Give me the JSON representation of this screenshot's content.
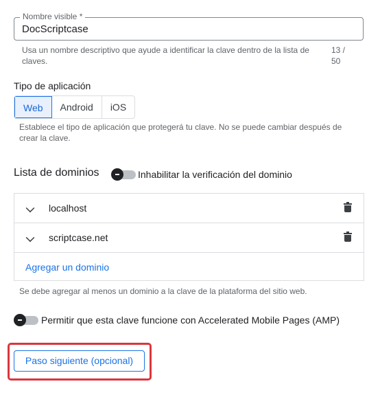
{
  "name_field": {
    "label": "Nombre visible *",
    "value": "DocScriptcase",
    "hint": "Usa un nombre descriptivo que ayude a identificar la clave dentro de la lista de claves.",
    "counter_current": "13 /",
    "counter_max": "50"
  },
  "app_type": {
    "title": "Tipo de aplicación",
    "options": [
      "Web",
      "Android",
      "iOS"
    ],
    "selected": "Web",
    "hint": "Establece el tipo de aplicación que protegerá tu clave. No se puede cambiar después de crear la clave."
  },
  "domains": {
    "title": "Lista de dominios",
    "toggle_label": "Inhabilitar la verificación del dominio",
    "items": [
      "localhost",
      "scriptcase.net"
    ],
    "add_label": "Agregar un dominio",
    "hint": "Se debe agregar al menos un dominio a la clave de la plataforma del sitio web."
  },
  "amp": {
    "toggle_label": "Permitir que esta clave funcione con Accelerated Mobile Pages (AMP)"
  },
  "next_button": {
    "label": "Paso siguiente (opcional)"
  },
  "colors": {
    "accent": "#1a73e8",
    "highlight_border": "#d9363e"
  }
}
